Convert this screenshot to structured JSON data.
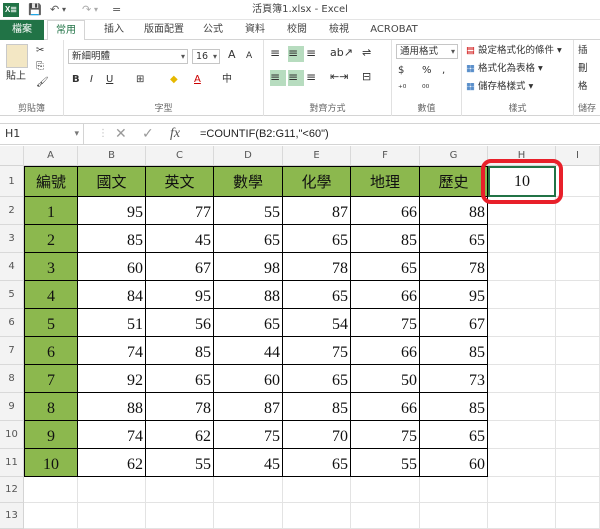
{
  "window": {
    "title": "活頁簿1.xlsx - Excel",
    "app_badge": "X≣"
  },
  "quick_access": {
    "save": "💾",
    "undo": "↶",
    "redo": "↷",
    "customize": "="
  },
  "tabs": [
    "檔案",
    "常用",
    "插入",
    "版面配置",
    "公式",
    "資料",
    "校閱",
    "檢視",
    "ACROBAT"
  ],
  "ribbon": {
    "clipboard": {
      "paste": "貼上",
      "cut": "✂",
      "copy": "⎘",
      "format_painter": "🖌",
      "group": "剪貼簿"
    },
    "font": {
      "name": "新細明體",
      "size": "16",
      "grow": "A",
      "shrink": "A",
      "bold": "B",
      "italic": "I",
      "underline": "U",
      "border": "⊞",
      "fill": "◆",
      "color": "A",
      "phonetic": "中",
      "group": "字型"
    },
    "alignment": {
      "group": "對齊方式"
    },
    "number": {
      "format": "通用格式",
      "currency": "$",
      "percent": "%",
      "comma": ",",
      "inc_dec": "⁺⁰",
      "dec_dec": "⁰⁰",
      "group": "數值"
    },
    "styles": {
      "conditional": "設定格式化的條件",
      "as_table": "格式化為表格",
      "cell_styles": "儲存格樣式",
      "group": "樣式"
    },
    "cells": {
      "insert": "插",
      "delete": "刪",
      "format": "格",
      "group": "儲存"
    }
  },
  "formula_bar": {
    "name_box": "H1",
    "cancel": "✕",
    "enter": "✓",
    "fx": "fx",
    "formula": "=COUNTIF(B2:G11,\"<60\")"
  },
  "grid": {
    "columns": [
      "A",
      "B",
      "C",
      "D",
      "E",
      "F",
      "G",
      "H",
      "I"
    ],
    "rows": [
      "1",
      "2",
      "3",
      "4",
      "5",
      "6",
      "7",
      "8",
      "9",
      "10",
      "11",
      "12",
      "13"
    ],
    "headers": [
      "編號",
      "國文",
      "英文",
      "數學",
      "化學",
      "地理",
      "歷史"
    ],
    "data": [
      [
        "1",
        "95",
        "77",
        "55",
        "87",
        "66",
        "88"
      ],
      [
        "2",
        "85",
        "45",
        "65",
        "65",
        "85",
        "65"
      ],
      [
        "3",
        "60",
        "67",
        "98",
        "78",
        "65",
        "78"
      ],
      [
        "4",
        "84",
        "95",
        "88",
        "65",
        "66",
        "95"
      ],
      [
        "5",
        "51",
        "56",
        "65",
        "54",
        "75",
        "67"
      ],
      [
        "6",
        "74",
        "85",
        "44",
        "75",
        "66",
        "85"
      ],
      [
        "7",
        "92",
        "65",
        "60",
        "65",
        "50",
        "73"
      ],
      [
        "8",
        "88",
        "78",
        "87",
        "85",
        "66",
        "85"
      ],
      [
        "9",
        "74",
        "62",
        "75",
        "70",
        "75",
        "65"
      ],
      [
        "10",
        "62",
        "55",
        "45",
        "65",
        "55",
        "60"
      ]
    ],
    "h1_value": "10"
  },
  "colors": {
    "accent": "#217346",
    "header_fill": "#8cb84e",
    "highlight_ring": "#e8202a"
  }
}
